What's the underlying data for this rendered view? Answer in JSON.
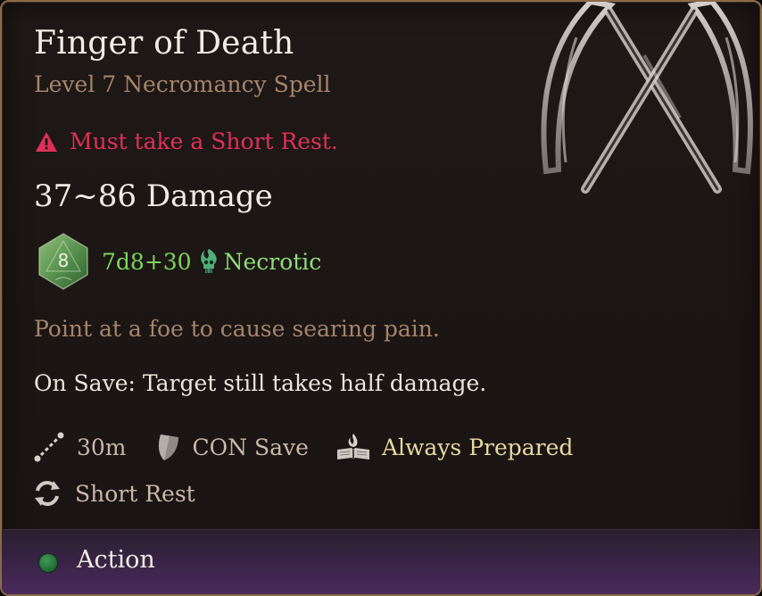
{
  "spell": {
    "name": "Finger of Death",
    "subtitle": "Level 7 Necromancy Spell",
    "warning": "Must take a Short Rest.",
    "damage_range": "37~86 Damage",
    "die_face": "8",
    "formula": "7d8+30",
    "damage_type": "Necrotic",
    "description": "Point at a foe to cause searing pain.",
    "on_save": "On Save: Target still takes half damage."
  },
  "properties": {
    "range": "30m",
    "save": "CON Save",
    "prepared": "Always Prepared",
    "recharge": "Short Rest"
  },
  "footer": {
    "cost": "Action"
  },
  "icons": {
    "spell_art": "crossed-scythes-icon",
    "warning": "warning-triangle-icon",
    "die": "d8-die-icon",
    "damage_type": "necrotic-skull-icon",
    "range": "range-icon",
    "save": "shield-icon",
    "prepared": "spellbook-icon",
    "recharge": "refresh-icon",
    "action": "action-dot-icon"
  },
  "colors": {
    "title": "#f1ece4",
    "subtitle": "#a5856a",
    "warning": "#e0305a",
    "formula": "#7fd45c",
    "necrotic": "#8fdc7a",
    "prepared": "#e8d9a0",
    "border": "#8a6a48",
    "action_dot": "#2f8a45"
  }
}
